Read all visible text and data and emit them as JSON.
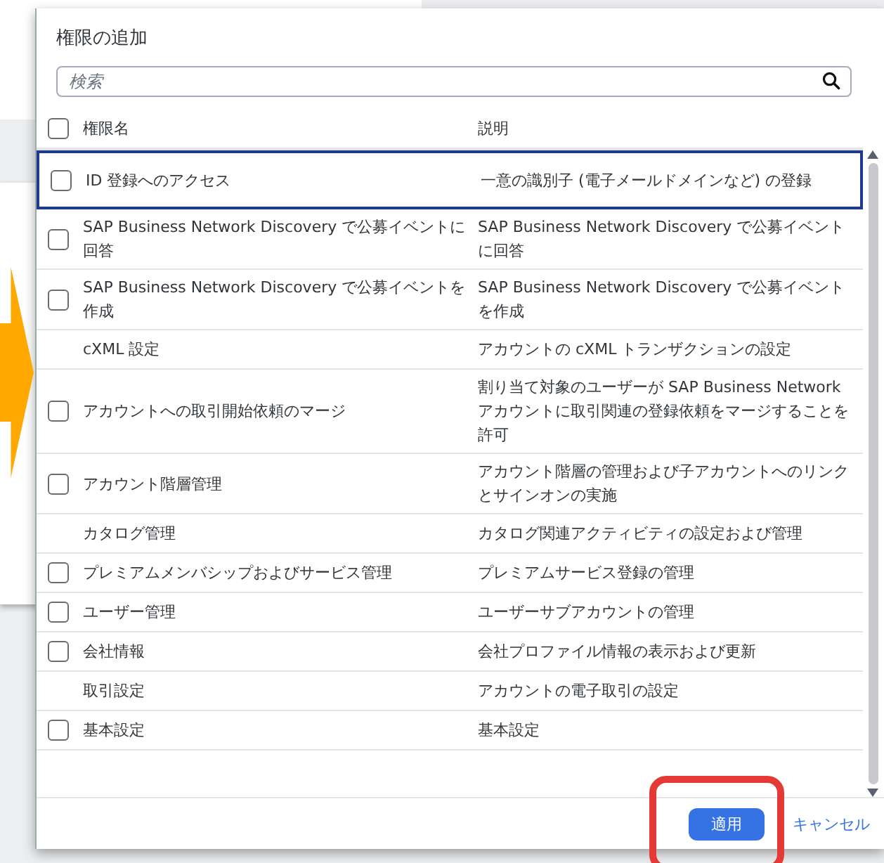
{
  "dialog": {
    "title": "権限の追加",
    "search": {
      "placeholder": "検索"
    },
    "columns": [
      {
        "label": "権限名"
      },
      {
        "label": "説明"
      }
    ],
    "header_checkbox": {
      "checked": false
    },
    "rows": [
      {
        "kind": "checkbox",
        "checked": false,
        "focused": true,
        "name": "ID 登録へのアクセス",
        "description": "一意の識別子 (電子メールドメインなど) の登録"
      },
      {
        "kind": "checkbox",
        "checked": false,
        "focused": false,
        "name": "SAP Business Network Discovery で公募イベントに回答",
        "description": "SAP Business Network Discovery で公募イベントに回答"
      },
      {
        "kind": "checkbox",
        "checked": false,
        "focused": false,
        "name": "SAP Business Network Discovery で公募イベントを作成",
        "description": "SAP Business Network Discovery で公募イベントを作成"
      },
      {
        "kind": "plain",
        "focused": false,
        "name": "cXML 設定",
        "description": "アカウントの cXML トランザクションの設定"
      },
      {
        "kind": "checkbox",
        "checked": false,
        "focused": false,
        "name": "アカウントへの取引開始依頼のマージ",
        "description": "割り当て対象のユーザーが SAP Business Network アカウントに取引関連の登録依頼をマージすることを許可"
      },
      {
        "kind": "checkbox",
        "checked": false,
        "focused": false,
        "name": "アカウント階層管理",
        "description": "アカウント階層の管理および子アカウントへのリンクとサインオンの実施"
      },
      {
        "kind": "plain",
        "focused": false,
        "name": "カタログ管理",
        "description": "カタログ関連アクティビティの設定および管理"
      },
      {
        "kind": "checkbox",
        "checked": false,
        "focused": false,
        "name": "プレミアムメンバシップおよびサービス管理",
        "description": "プレミアムサービス登録の管理"
      },
      {
        "kind": "checkbox",
        "checked": false,
        "focused": false,
        "name": "ユーザー管理",
        "description": "ユーザーサブアカウントの管理"
      },
      {
        "kind": "checkbox",
        "checked": false,
        "focused": false,
        "name": "会社情報",
        "description": "会社プロファイル情報の表示および更新"
      },
      {
        "kind": "plain",
        "focused": false,
        "name": "取引設定",
        "description": "アカウントの電子取引の設定"
      },
      {
        "kind": "checkbox",
        "checked": false,
        "focused": false,
        "name": "基本設定",
        "description": "基本設定"
      }
    ],
    "buttons": [
      {
        "kind": "primary",
        "label": "適用"
      },
      {
        "kind": "link",
        "label": "キャンセル"
      }
    ]
  }
}
